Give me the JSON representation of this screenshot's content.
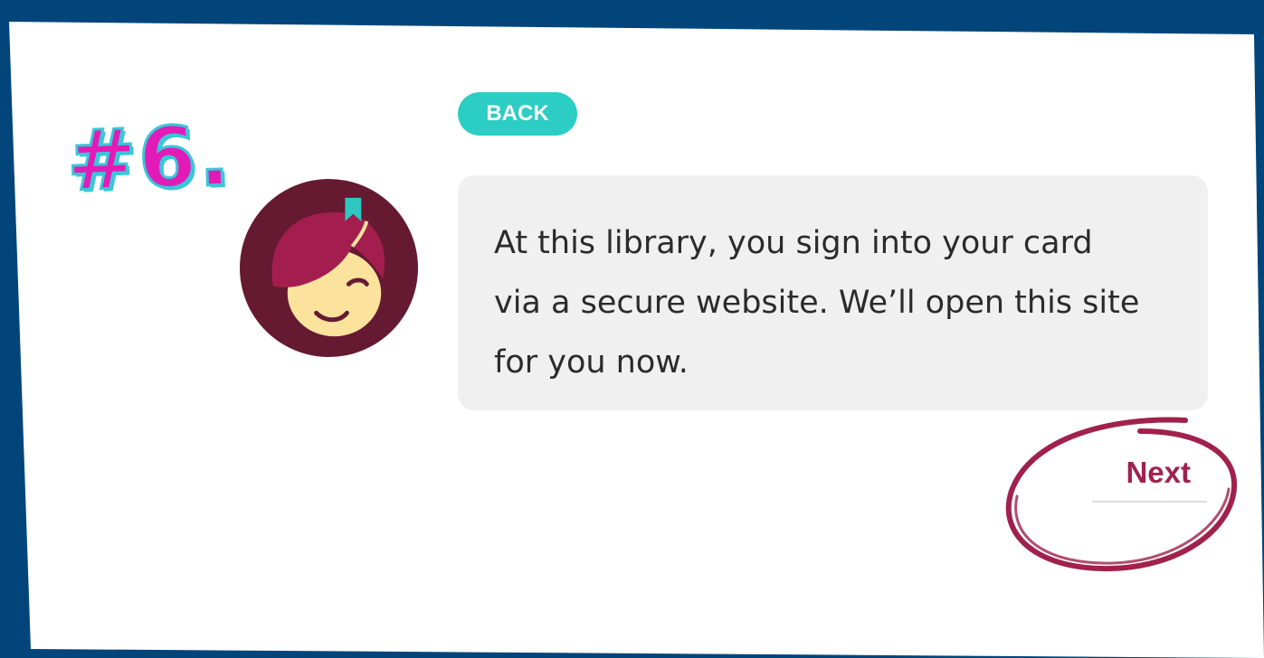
{
  "step": {
    "label": "#6."
  },
  "buttons": {
    "back_label": "BACK",
    "next_label": "Next"
  },
  "message": {
    "line1": "At this library, you sign into your card",
    "line2": "via a secure website. We’ll open this site",
    "line3": "for you now."
  },
  "icons": {
    "avatar": "libby-avatar-icon",
    "highlight": "circle-highlight"
  },
  "colors": {
    "frame": "#02457a",
    "back_button": "#2ccdc2",
    "next_text": "#a0224c",
    "step_label": "#e21bb8",
    "step_outline": "#39c7d8",
    "avatar_bg": "#651a32"
  }
}
